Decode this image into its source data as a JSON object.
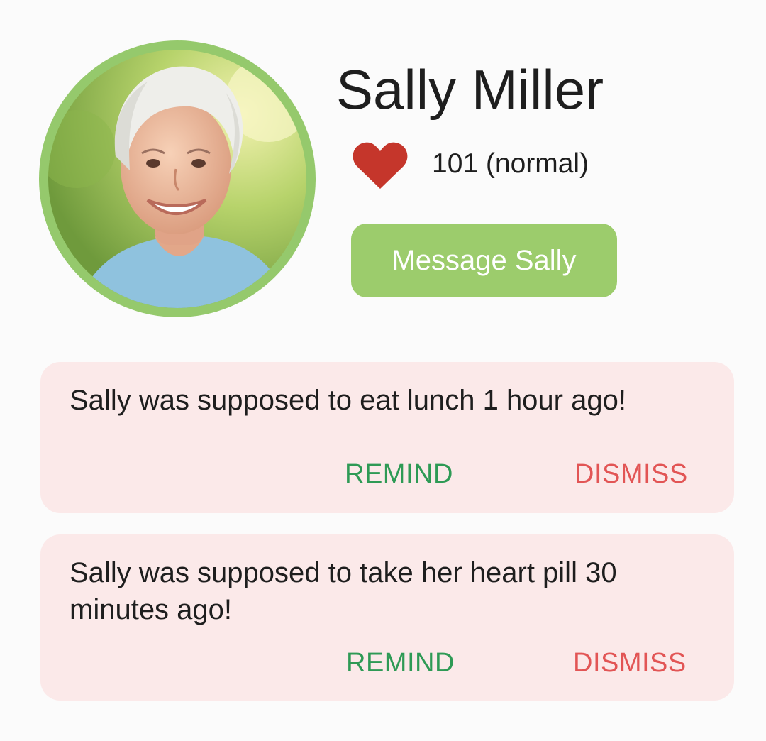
{
  "profile": {
    "name": "Sally Miller",
    "heart_rate_text": "101 (normal)",
    "message_button_label": "Message Sally",
    "avatar_icon": "profile-photo",
    "heart_icon": "heart-icon",
    "accent_color": "#95c96c",
    "heart_color": "#c5362b"
  },
  "alerts": [
    {
      "text": "Sally was supposed to eat lunch 1 hour ago!",
      "remind_label": "REMIND",
      "dismiss_label": "DISMISS"
    },
    {
      "text": "Sally was supposed to take her heart pill 30 minutes ago!",
      "remind_label": "REMIND",
      "dismiss_label": "DISMISS"
    }
  ],
  "colors": {
    "card_background": "#fbe9e9",
    "remind": "#2e9a55",
    "dismiss": "#e25555",
    "button_background": "#9ccc6c"
  }
}
